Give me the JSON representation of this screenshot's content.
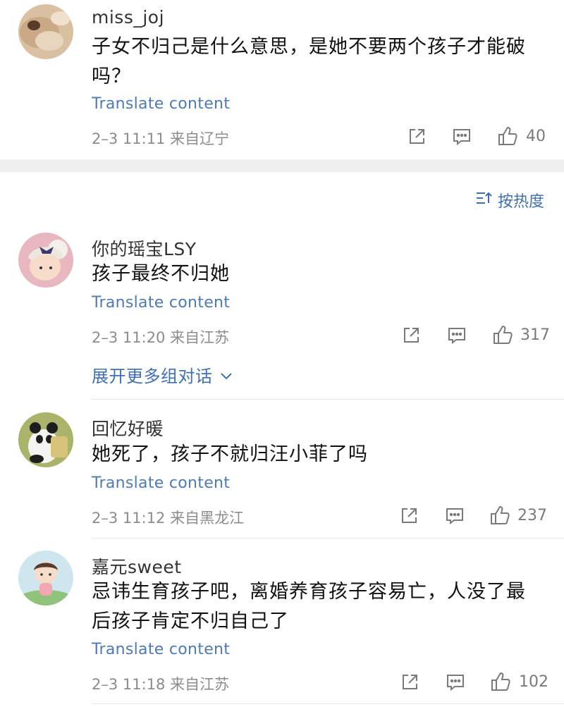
{
  "sort": {
    "label": "按热度"
  },
  "comments": [
    {
      "username": "miss_joj",
      "text": "子女不归己是什么意思，是她不要两个孩子才能破吗？",
      "translate": "Translate content",
      "meta": "2–3 11:11  来自辽宁",
      "likes": "40"
    },
    {
      "username": "你的瑶宝LSY",
      "text": "孩子最终不归她",
      "translate": "Translate content",
      "meta": "2–3 11:20  来自江苏",
      "likes": "317",
      "expand": "展开更多组对话"
    },
    {
      "username": "回忆好暖",
      "text": "她死了，孩子不就归汪小菲了吗",
      "translate": "Translate content",
      "meta": "2–3 11:12  来自黑龙江",
      "likes": "237"
    },
    {
      "username": "嘉元sweet",
      "text": "忌讳生育孩子吧，离婚养育孩子容易亡，人没了最后孩子肯定不归自己了",
      "translate": "Translate content",
      "meta": "2–3 11:18  来自江苏",
      "likes": "102"
    }
  ]
}
